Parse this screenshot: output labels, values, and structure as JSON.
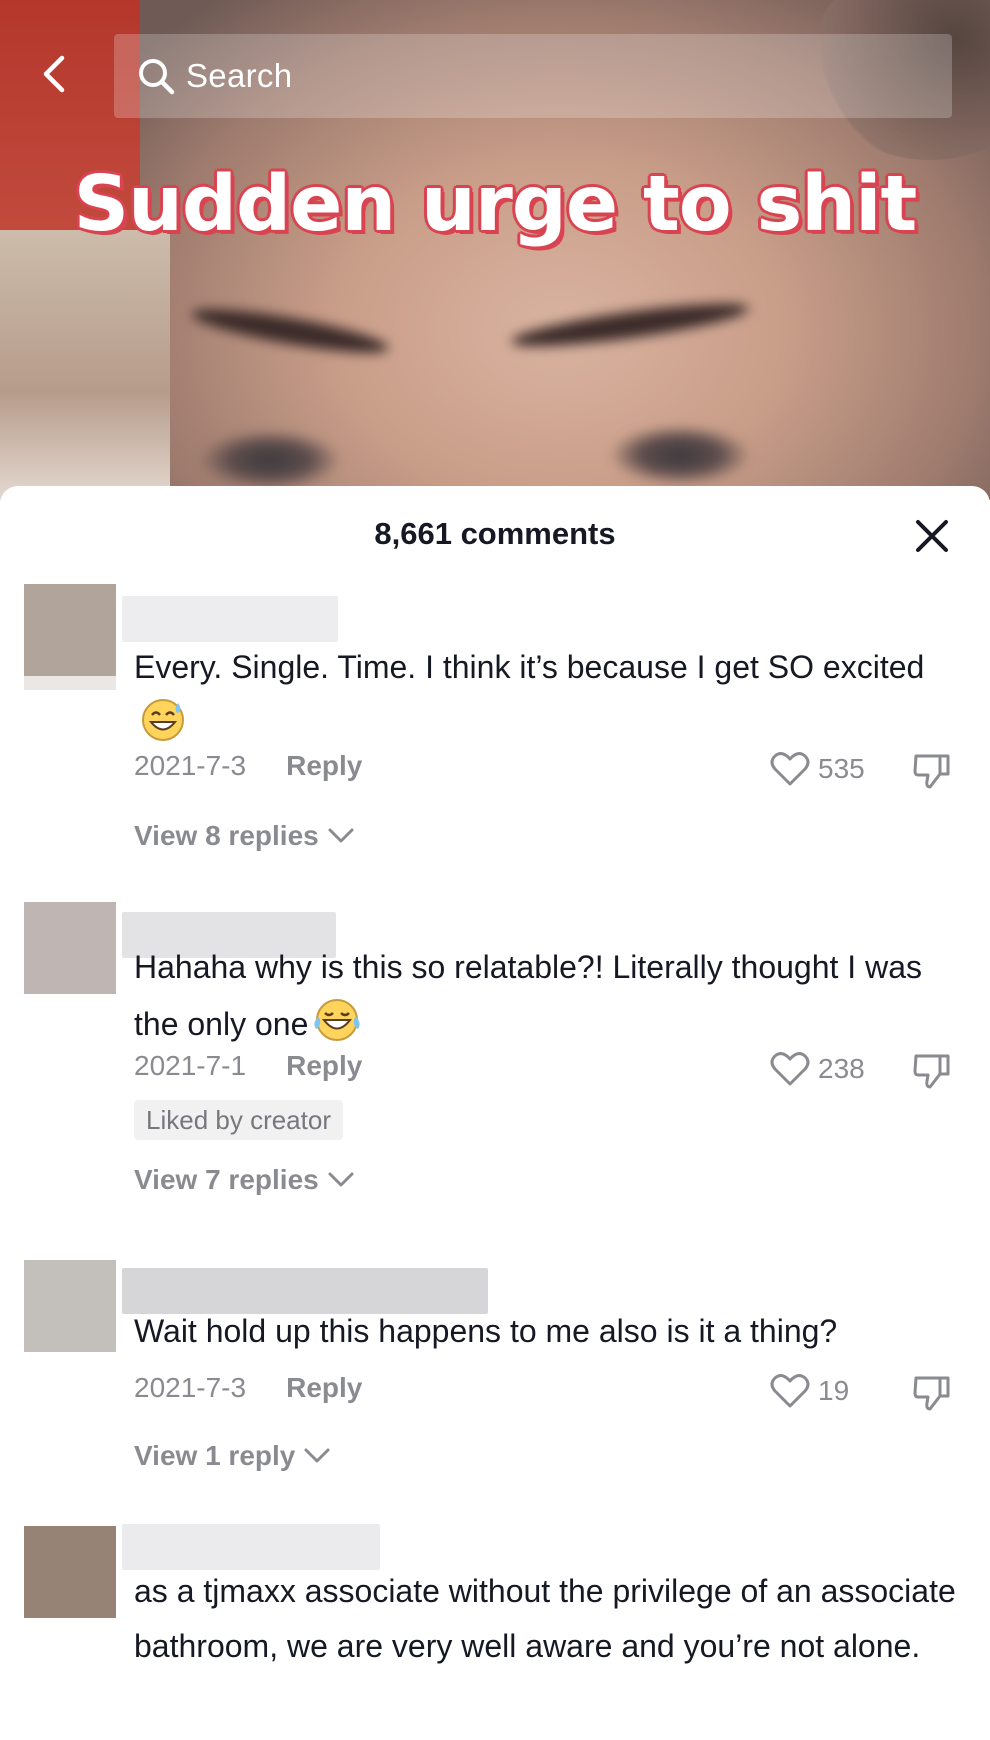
{
  "search": {
    "placeholder": "Search"
  },
  "video": {
    "caption": "Sudden urge to shit"
  },
  "comments_panel": {
    "title": "8,661 comments",
    "comments": [
      {
        "text": "Every. Single. Time. I think it’s because I get SO excited",
        "emoji": "sweat-smile-emoji",
        "date": "2021-7-3",
        "reply_label": "Reply",
        "likes": "535",
        "view_replies": "View 8 replies",
        "avatar_color": "#b0a49b"
      },
      {
        "text": "Hahaha why is this so relatable?! Literally thought I was the only one",
        "emoji": "tears-of-joy-emoji",
        "date": "2021-7-1",
        "reply_label": "Reply",
        "likes": "238",
        "badge": "Liked by creator",
        "view_replies": "View 7 replies",
        "avatar_color": "#bfb5b3"
      },
      {
        "text": "Wait hold up this happens to me also is it a thing?",
        "date": "2021-7-3",
        "reply_label": "Reply",
        "likes": "19",
        "view_replies": "View 1 reply",
        "avatar_color": "#c3c0bb"
      },
      {
        "text": "as a tjmaxx associate without the privilege of an associate bathroom, we are very well aware and you’re not alone.",
        "avatar_color": "#968376"
      }
    ]
  },
  "colors": {
    "text": "#161823",
    "muted": "#8a8b91",
    "caption_outline": "#d94552"
  }
}
